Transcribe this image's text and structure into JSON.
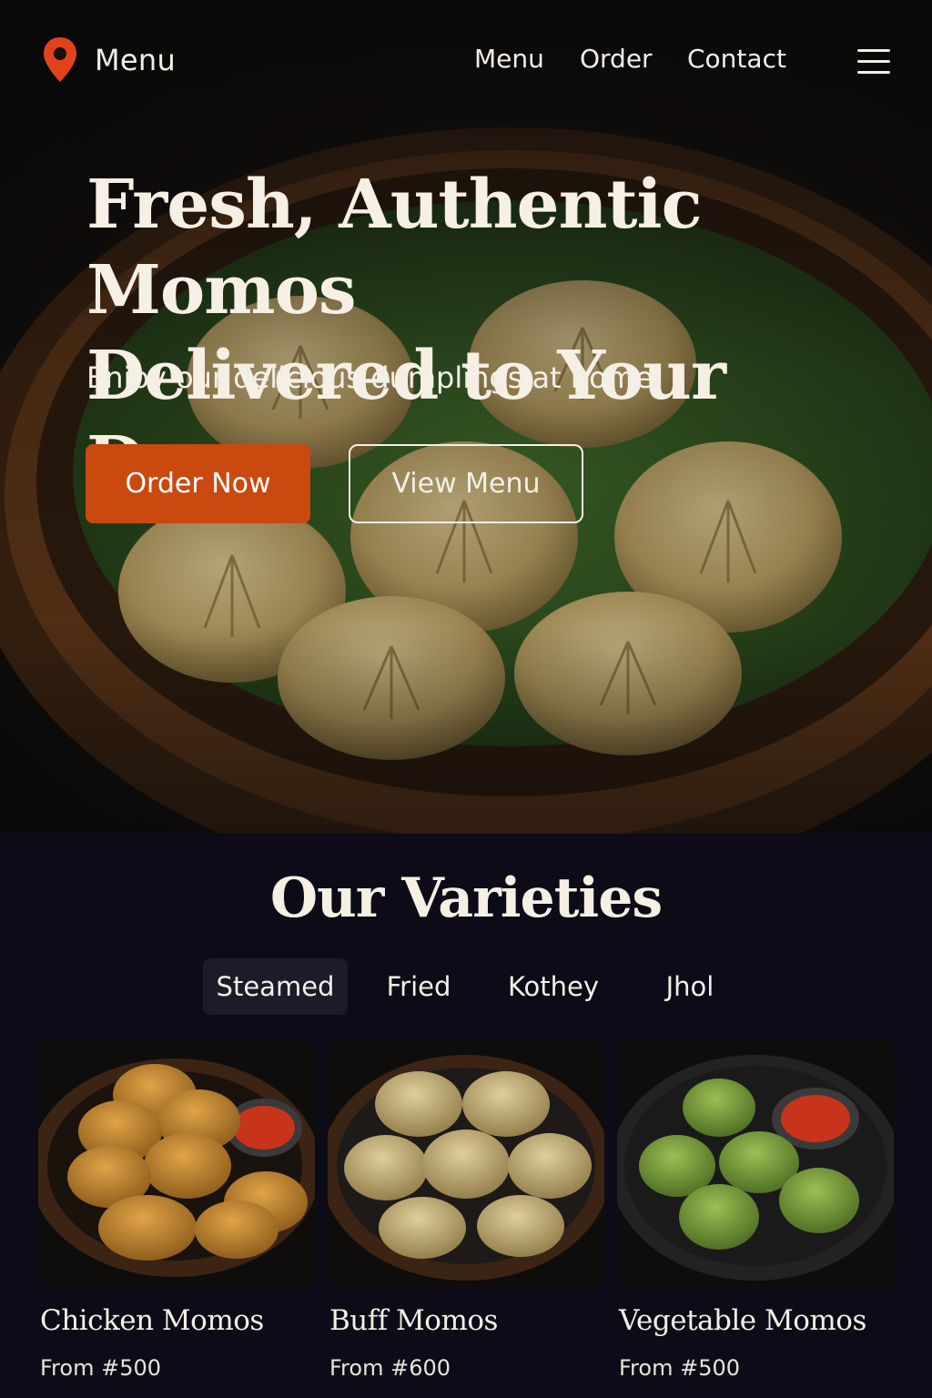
{
  "header": {
    "brand_label": "Menu",
    "nav": [
      "Menu",
      "Order",
      "Contact"
    ]
  },
  "hero": {
    "title_line1": "Fresh, Authentic Momos",
    "title_line2": "Delivered to Your Door",
    "subtitle": "Enjoy our delicious dumplings at home",
    "primary_cta": "Order Now",
    "secondary_cta": "View Menu"
  },
  "varieties": {
    "title": "Our Varieties",
    "tabs": [
      "Steamed",
      "Fried",
      "Kothey",
      "Jhol"
    ],
    "active_tab": "Steamed",
    "items": [
      {
        "name": "Chicken Momos",
        "price": "From #500"
      },
      {
        "name": "Buff Momos",
        "price": "From #600"
      },
      {
        "name": "Vegetable Momos",
        "price": "From #500"
      }
    ]
  },
  "colors": {
    "accent": "#c9490f",
    "pin": "#e2421b",
    "background": "#0c0b17",
    "text": "#f3efe6"
  },
  "icons": [
    "map-pin-icon",
    "hamburger-menu-icon"
  ]
}
